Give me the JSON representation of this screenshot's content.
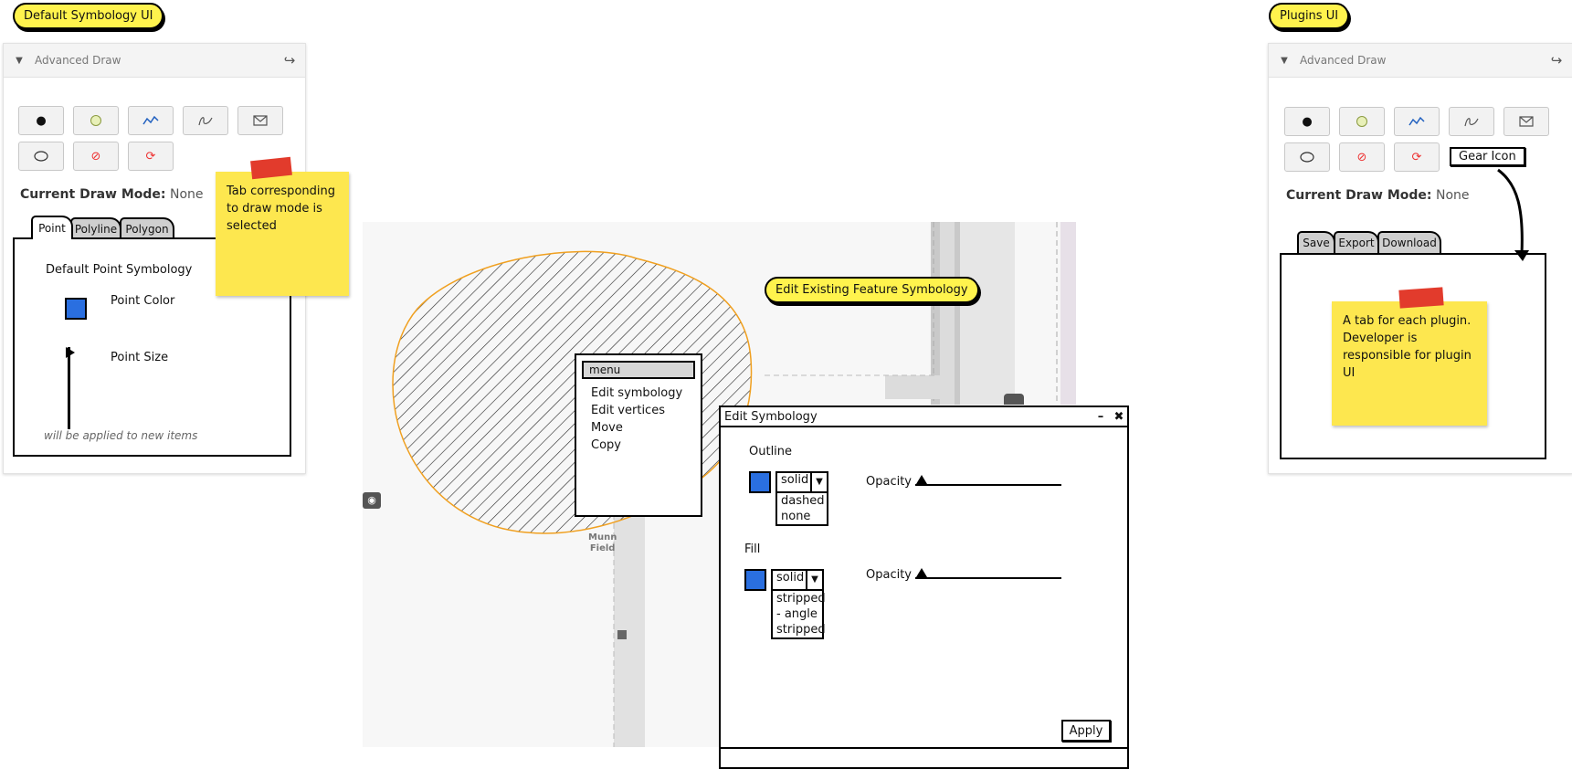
{
  "labels": {
    "default_ui": "Default Symbology UI",
    "plugins_ui": "Plugins UI",
    "edit_existing": "Edit Existing Feature Symbology",
    "gear_icon": "Gear Icon"
  },
  "left_panel": {
    "title": "Advanced Draw",
    "current_mode_label": "Current Draw Mode:",
    "current_mode_value": "None",
    "tabs": [
      "Point",
      "Polyline",
      "Polygon"
    ],
    "symbology_title": "Default Point Symbology",
    "point_color_label": "Point Color",
    "point_size_label": "Point Size",
    "footer_note": "will be applied to new items",
    "sticky": "Tab corresponding to draw mode is selected"
  },
  "right_panel": {
    "title": "Advanced Draw",
    "current_mode_label": "Current Draw Mode:",
    "current_mode_value": "None",
    "tabs": [
      "Save",
      "Export",
      "Download"
    ],
    "sticky": "A tab for each plugin. Developer is responsible for plugin UI"
  },
  "map": {
    "label_line1": "Munn",
    "label_line2": "Field"
  },
  "context_menu": {
    "header": "menu",
    "items": [
      "Edit symbology",
      "Edit vertices",
      "Move",
      "Copy"
    ]
  },
  "dialog": {
    "title": "Edit Symbology",
    "outline_label": "Outline",
    "outline_selected": "solid",
    "outline_options": [
      "dashed",
      "none"
    ],
    "fill_label": "Fill",
    "fill_selected": "solid",
    "fill_options": [
      "stripped",
      "- angle",
      "stripped"
    ],
    "opacity_label": "Opacity",
    "apply": "Apply"
  },
  "colors": {
    "sticky": "#fde74f",
    "pill": "#fff34d",
    "swatch": "#2a6fe0",
    "polygon_outline": "#f0a020"
  }
}
